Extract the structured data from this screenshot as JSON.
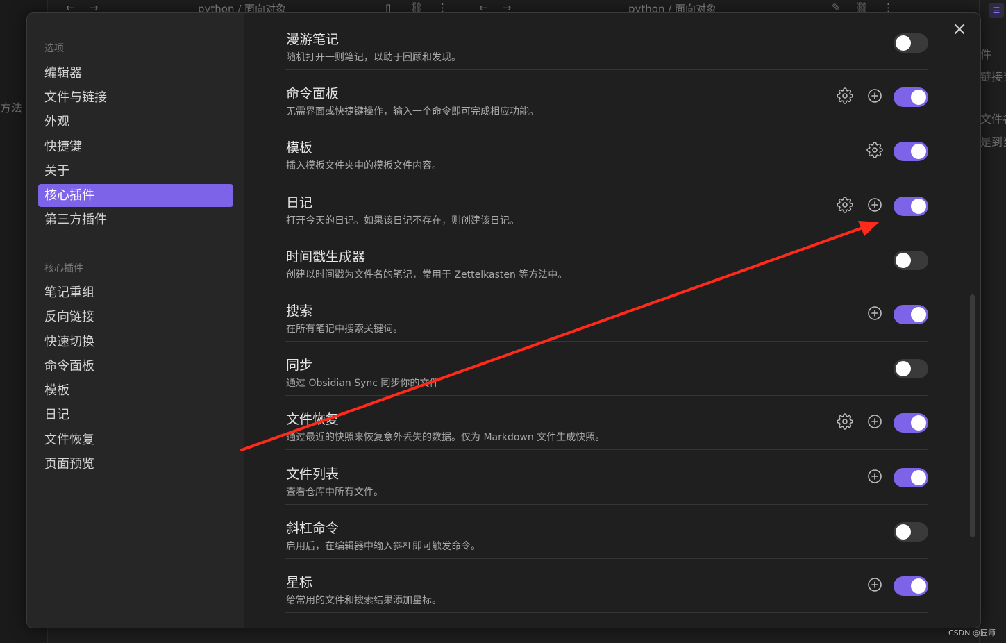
{
  "background": {
    "left_tab_title": "python / 面向对象",
    "right_tab_title": "python / 面向对象",
    "left_edge_text": "方法",
    "right_edge_lines": [
      "件",
      "链接当",
      "文件名",
      "是到当"
    ],
    "watermark": "CSDN @匠师"
  },
  "sidebar": {
    "options_heading": "选项",
    "options": [
      {
        "label": "编辑器"
      },
      {
        "label": "文件与链接"
      },
      {
        "label": "外观"
      },
      {
        "label": "快捷键"
      },
      {
        "label": "关于"
      },
      {
        "label": "核心插件",
        "active": true
      },
      {
        "label": "第三方插件"
      }
    ],
    "plugins_heading": "核心插件",
    "plugins": [
      {
        "label": "笔记重组"
      },
      {
        "label": "反向链接"
      },
      {
        "label": "快速切换"
      },
      {
        "label": "命令面板"
      },
      {
        "label": "模板"
      },
      {
        "label": "日记"
      },
      {
        "label": "文件恢复"
      },
      {
        "label": "页面预览"
      }
    ]
  },
  "close_icon": "×",
  "plugins": [
    {
      "name": "漫游笔记",
      "desc": "随机打开一则笔记，以助于回顾和发现。",
      "settings": false,
      "add": false,
      "enabled": false
    },
    {
      "name": "命令面板",
      "desc": "无需界面或快捷键操作，输入一个命令即可完成相应功能。",
      "settings": true,
      "add": true,
      "enabled": true
    },
    {
      "name": "模板",
      "desc": "插入模板文件夹中的模板文件内容。",
      "settings": true,
      "add": false,
      "enabled": true
    },
    {
      "name": "日记",
      "desc": "打开今天的日记。如果该日记不存在，则创建该日记。",
      "settings": true,
      "add": true,
      "enabled": true
    },
    {
      "name": "时间戳生成器",
      "desc": "创建以时间戳为文件名的笔记，常用于 Zettelkasten 等方法中。",
      "settings": false,
      "add": false,
      "enabled": false
    },
    {
      "name": "搜索",
      "desc": "在所有笔记中搜索关键词。",
      "settings": false,
      "add": true,
      "enabled": true
    },
    {
      "name": "同步",
      "desc": "通过 Obsidian Sync 同步你的文件",
      "settings": false,
      "add": false,
      "enabled": false
    },
    {
      "name": "文件恢复",
      "desc": "通过最近的快照来恢复意外丢失的数据。仅为 Markdown 文件生成快照。",
      "settings": true,
      "add": true,
      "enabled": true
    },
    {
      "name": "文件列表",
      "desc": "查看仓库中所有文件。",
      "settings": false,
      "add": true,
      "enabled": true
    },
    {
      "name": "斜杠命令",
      "desc": "启用后，在编辑器中输入斜杠即可触发命令。",
      "settings": false,
      "add": false,
      "enabled": false
    },
    {
      "name": "星标",
      "desc": "给常用的文件和搜索结果添加星标。",
      "settings": false,
      "add": true,
      "enabled": true
    }
  ],
  "colors": {
    "accent": "#7c63e8",
    "annotation_arrow": "#ff2a1a"
  }
}
